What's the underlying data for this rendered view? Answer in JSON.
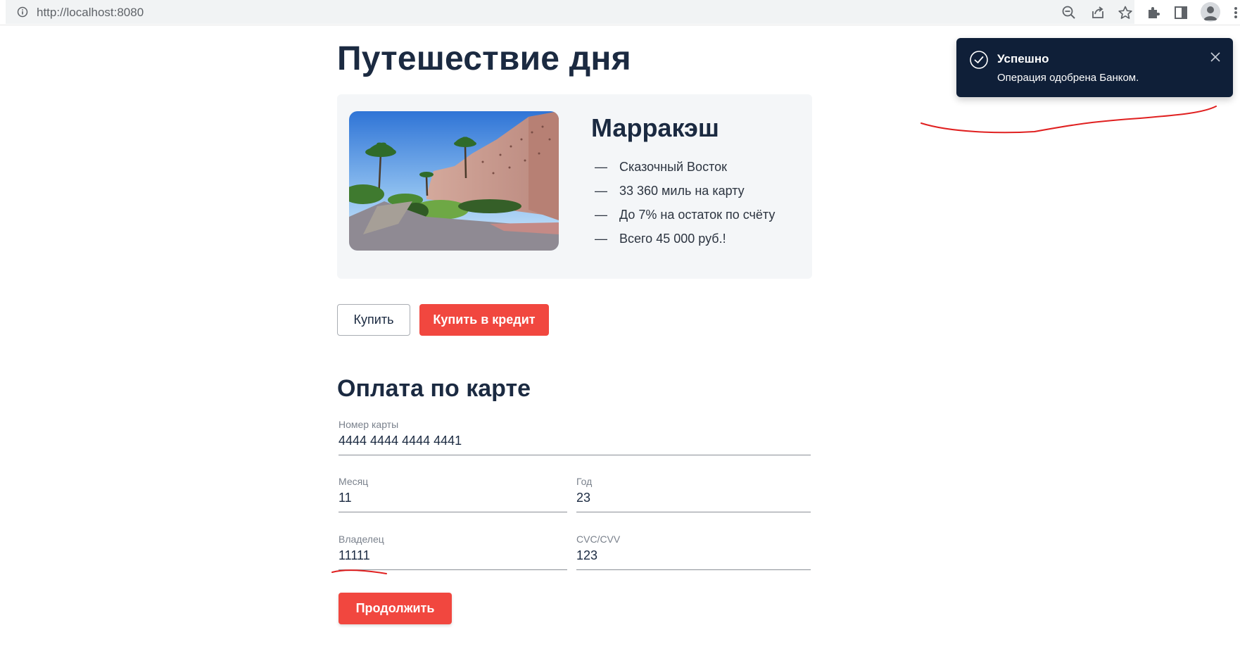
{
  "browser": {
    "url": "http://localhost:8080",
    "icons": [
      "info-icon",
      "zoom-out-icon",
      "share-icon",
      "star-icon",
      "extensions-icon",
      "sidebar-icon",
      "profile-icon",
      "menu-icon"
    ]
  },
  "page": {
    "title": "Путешествие дня"
  },
  "card": {
    "title": "Марракэш",
    "image": "marrakesh-photo",
    "features": [
      {
        "dash": "—",
        "text": "Сказочный Восток"
      },
      {
        "dash": "—",
        "text": "33 360 миль на карту"
      },
      {
        "dash": "—",
        "text": "До 7% на остаток по счёту"
      },
      {
        "dash": "—",
        "text": "Всего 45 000 руб.!"
      }
    ]
  },
  "actions": {
    "buy_label": "Купить",
    "credit_label": "Купить в кредит"
  },
  "payment": {
    "title": "Оплата по карте",
    "card_number": {
      "label": "Номер карты",
      "value": "4444 4444 4444 4441"
    },
    "month": {
      "label": "Месяц",
      "value": "11"
    },
    "year": {
      "label": "Год",
      "value": "23"
    },
    "owner": {
      "label": "Владелец",
      "value": "11111"
    },
    "cvc": {
      "label": "CVC/CVV",
      "value": "123"
    },
    "continue_label": "Продолжить"
  },
  "toast": {
    "title": "Успешно",
    "message": "Операция одобрена Банком."
  },
  "colors": {
    "accent": "#f1473f",
    "text_dark": "#1b2a41",
    "toast_bg": "#0f1f38",
    "card_bg": "#f4f6f8",
    "annotation": "#e02020"
  }
}
